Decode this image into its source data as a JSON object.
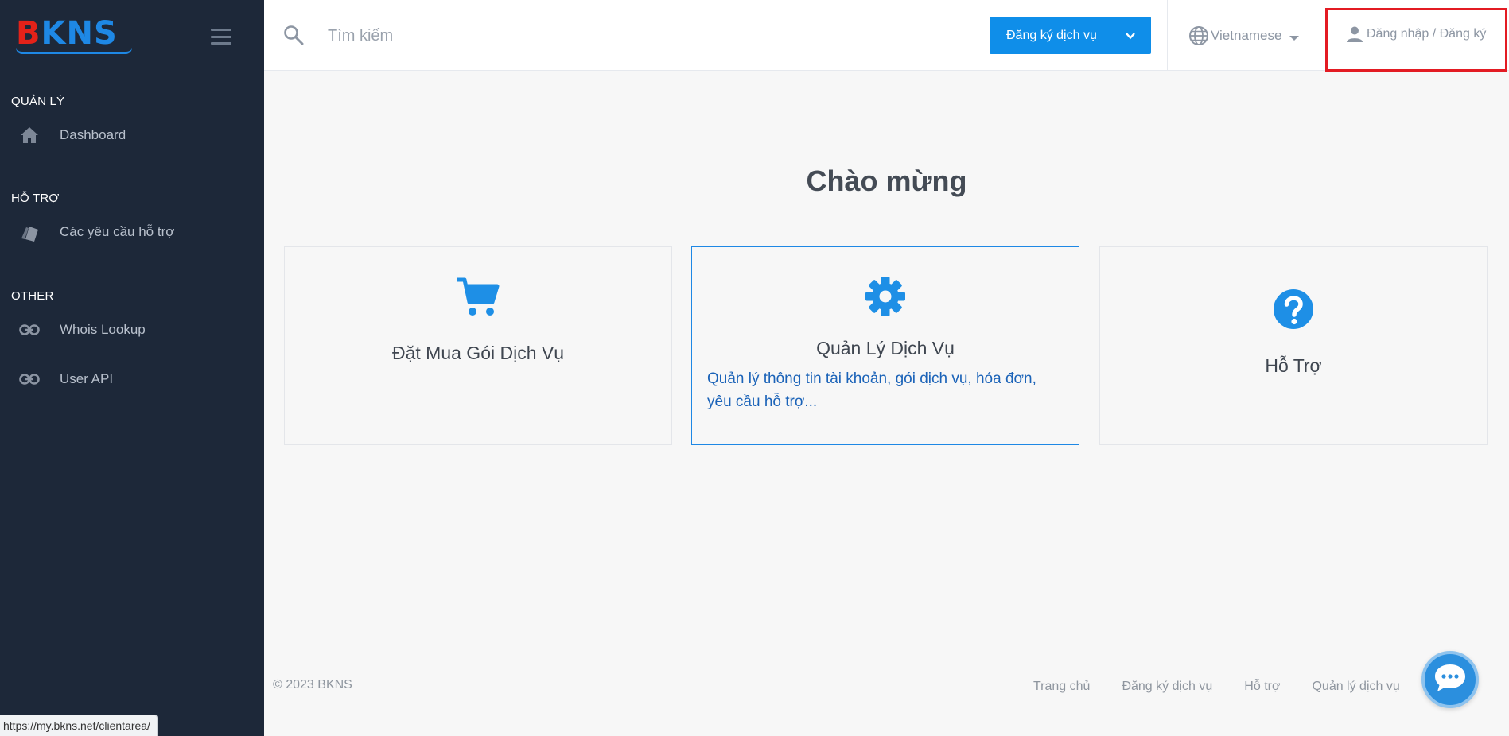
{
  "brand": {
    "logo_b": "B",
    "logo_kns": "KNS"
  },
  "sidebar": {
    "sections": [
      {
        "title": "QUẢN LÝ",
        "items": [
          {
            "label": "Dashboard",
            "icon": "home-icon"
          }
        ]
      },
      {
        "title": "HỖ TRỢ",
        "items": [
          {
            "label": "Các yêu cầu hỗ trợ",
            "icon": "tickets-icon"
          }
        ]
      },
      {
        "title": "OTHER",
        "items": [
          {
            "label": "Whois Lookup",
            "icon": "link-icon"
          },
          {
            "label": "User API",
            "icon": "link-icon"
          }
        ]
      }
    ]
  },
  "header": {
    "search_placeholder": "Tìm kiếm",
    "register_label": "Đăng ký dịch vụ",
    "language": "Vietnamese",
    "login_label": "Đăng nhập / Đăng ký"
  },
  "main": {
    "welcome": "Chào mừng",
    "cards": [
      {
        "title": "Đặt Mua Gói Dịch Vụ",
        "icon": "cart-icon"
      },
      {
        "title": "Quản Lý Dịch Vụ",
        "icon": "gear-icon",
        "description": "Quản lý thông tin tài khoản, gói dịch vụ, hóa đơn, yêu cầu hỗ trợ..."
      },
      {
        "title": "Hỗ Trợ",
        "icon": "help-icon"
      }
    ]
  },
  "footer": {
    "copyright": "© 2023 BKNS",
    "links": [
      "Trang chủ",
      "Đăng ký dịch vụ",
      "Hỗ trợ",
      "Quản lý dịch vụ"
    ]
  },
  "status_bar": {
    "url": "https://my.bkns.net/clientarea/"
  },
  "colors": {
    "accent": "#0f8ee9",
    "sidebar_bg": "#1d2839",
    "highlight_box": "#e31b23",
    "logo_red": "#e32219",
    "logo_blue": "#1e88e5"
  }
}
